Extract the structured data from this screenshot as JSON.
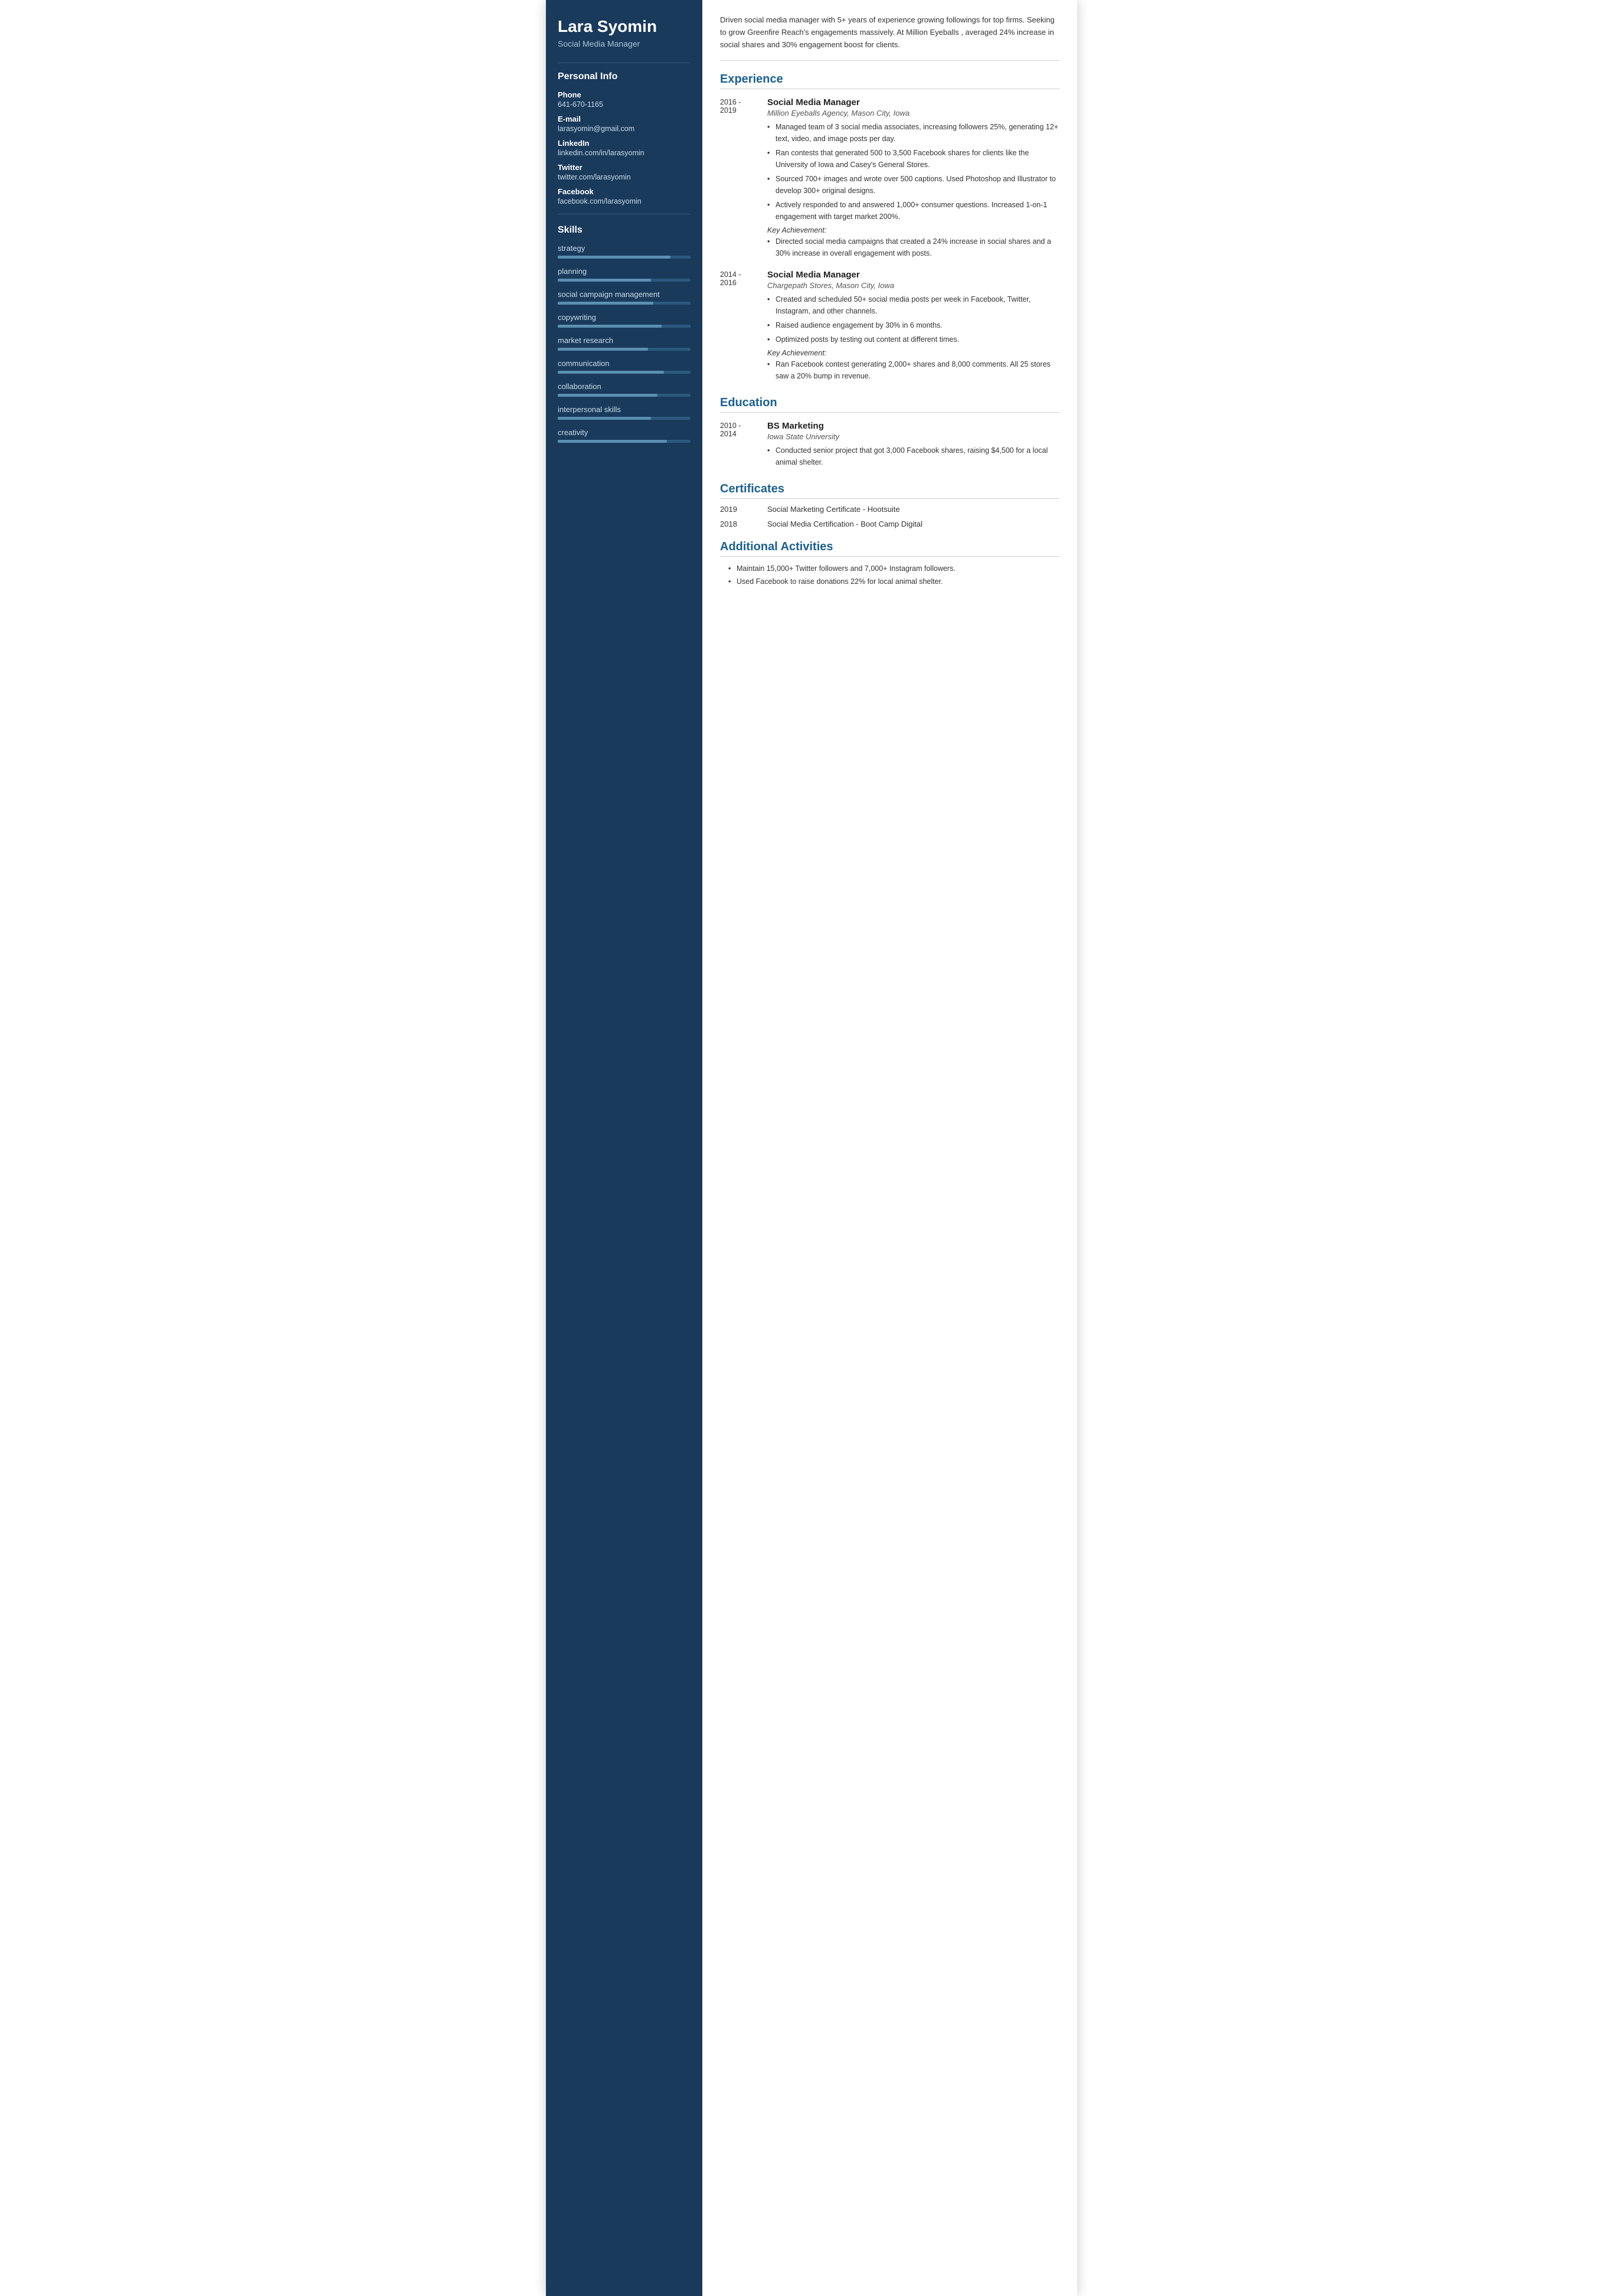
{
  "sidebar": {
    "name": "Lara Syomin",
    "job_title": "Social Media Manager",
    "personal_info": {
      "section_title": "Personal Info",
      "phone_label": "Phone",
      "phone_value": "641-670-1165",
      "email_label": "E-mail",
      "email_value": "larasyomin@gmail.com",
      "linkedin_label": "LinkedIn",
      "linkedin_value": "linkedin.com/in/larasyomin",
      "twitter_label": "Twitter",
      "twitter_value": "twitter.com/larasyomin",
      "facebook_label": "Facebook",
      "facebook_value": "facebook.com/larasyomin"
    },
    "skills": {
      "section_title": "Skills",
      "items": [
        {
          "name": "strategy",
          "fill": 85,
          "accent": false
        },
        {
          "name": "planning",
          "fill": 70,
          "accent": true
        },
        {
          "name": "social campaign management",
          "fill": 72,
          "accent": false
        },
        {
          "name": "copywriting",
          "fill": 78,
          "accent": true
        },
        {
          "name": "market research",
          "fill": 68,
          "accent": false
        },
        {
          "name": "communication",
          "fill": 80,
          "accent": false
        },
        {
          "name": "collaboration",
          "fill": 75,
          "accent": false
        },
        {
          "name": "interpersonal skills",
          "fill": 70,
          "accent": true
        },
        {
          "name": "creativity",
          "fill": 82,
          "accent": false
        }
      ]
    }
  },
  "main": {
    "summary": "Driven social media manager with 5+ years of experience growing followings for top firms. Seeking to grow Greenfire Reach's engagements massively. At Million Eyeballs , averaged 24% increase in social shares and 30% engagement boost for clients.",
    "experience": {
      "section_title": "Experience",
      "entries": [
        {
          "date_start": "2016 -",
          "date_end": "2019",
          "job_title": "Social Media Manager",
          "company": "Million Eyeballs Agency, Mason City, Iowa",
          "bullets": [
            "Managed team of 3 social media associates, increasing followers 25%, generating 12+ text, video, and image posts per day.",
            "Ran contests that generated 500 to 3,500 Facebook shares for clients like the University of Iowa and Casey's General Stores.",
            "Sourced 700+ images and wrote over 500 captions. Used Photoshop and Illustrator to develop 300+ original designs.",
            "Actively responded to and answered 1,000+ consumer questions. Increased 1-on-1 engagement with target market 200%."
          ],
          "key_achievement_label": "Key Achievement:",
          "key_achievements": [
            "Directed social media campaigns that created a 24% increase in social shares and a 30% increase in overall engagement with posts."
          ]
        },
        {
          "date_start": "2014 -",
          "date_end": "2016",
          "job_title": "Social Media Manager",
          "company": "Chargepath Stores, Mason City, Iowa",
          "bullets": [
            "Created and scheduled 50+ social media posts per week in Facebook, Twitter, Instagram, and other channels.",
            "Raised audience engagement by 30% in 6 months.",
            "Optimized posts by testing out content at different times."
          ],
          "key_achievement_label": "Key Achievement:",
          "key_achievements": [
            "Ran Facebook contest generating 2,000+ shares and 8,000 comments. All 25 stores saw a 20% bump in revenue."
          ]
        }
      ]
    },
    "education": {
      "section_title": "Education",
      "entries": [
        {
          "date_start": "2010 -",
          "date_end": "2014",
          "degree": "BS Marketing",
          "institution": "Iowa State University",
          "bullets": [
            "Conducted senior project that got 3,000 Facebook shares, raising $4,500 for a local animal shelter."
          ]
        }
      ]
    },
    "certificates": {
      "section_title": "Certificates",
      "entries": [
        {
          "year": "2019",
          "name": "Social Marketing Certificate - Hootsuite"
        },
        {
          "year": "2018",
          "name": "Social Media Certification - Boot Camp Digital"
        }
      ]
    },
    "additional_activities": {
      "section_title": "Additional Activities",
      "bullets": [
        "Maintain 15,000+ Twitter followers and 7,000+ Instagram followers.",
        "Used Facebook to raise donations 22% for local animal shelter."
      ]
    }
  }
}
